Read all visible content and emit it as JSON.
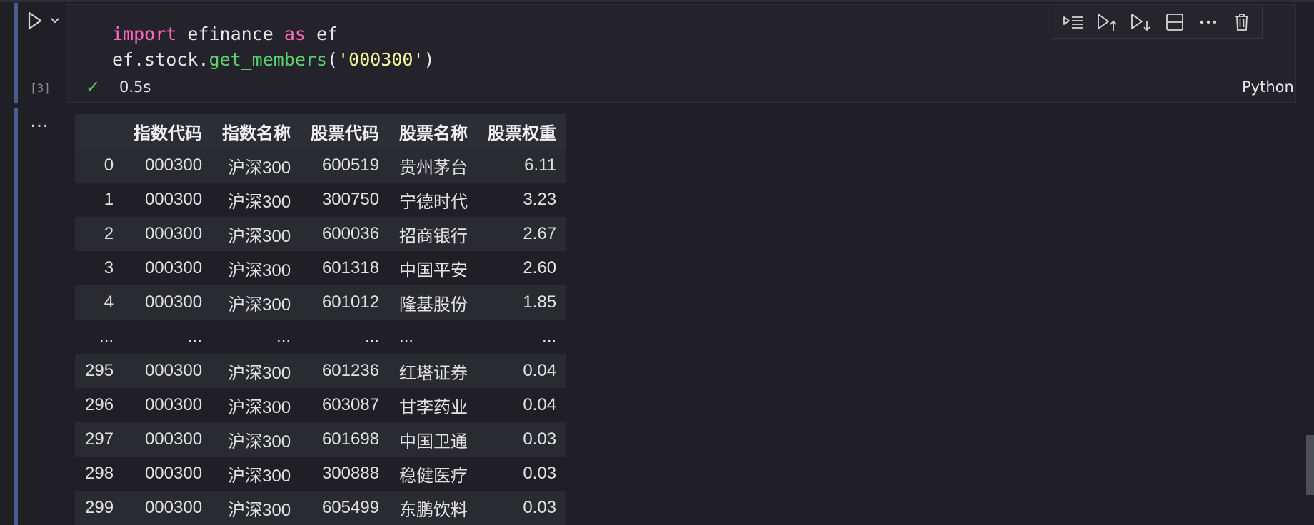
{
  "cell": {
    "execution_count": "[3]",
    "code_lines": [
      [
        {
          "t": "import",
          "c": "kw"
        },
        {
          "t": " efinance ",
          "c": ""
        },
        {
          "t": "as",
          "c": "kw"
        },
        {
          "t": " ef",
          "c": ""
        }
      ],
      [
        {
          "t": "ef.stock.",
          "c": ""
        },
        {
          "t": "get_members",
          "c": "fn"
        },
        {
          "t": "(",
          "c": ""
        },
        {
          "t": "'000300'",
          "c": "str"
        },
        {
          "t": ")",
          "c": ""
        }
      ]
    ],
    "duration": "0.5s",
    "language": "Python"
  },
  "toolbar": {
    "actions": [
      "run-by-line",
      "execute-above",
      "execute-below",
      "split-cell",
      "more",
      "delete"
    ]
  },
  "output": {
    "more_label": "…",
    "columns": [
      "",
      "指数代码",
      "指数名称",
      "股票代码",
      "股票名称",
      "股票权重"
    ],
    "rows": [
      [
        "0",
        "000300",
        "沪深300",
        "600519",
        "贵州茅台",
        "6.11"
      ],
      [
        "1",
        "000300",
        "沪深300",
        "300750",
        "宁德时代",
        "3.23"
      ],
      [
        "2",
        "000300",
        "沪深300",
        "600036",
        "招商银行",
        "2.67"
      ],
      [
        "3",
        "000300",
        "沪深300",
        "601318",
        "中国平安",
        "2.60"
      ],
      [
        "4",
        "000300",
        "沪深300",
        "601012",
        "隆基股份",
        "1.85"
      ],
      [
        "...",
        "...",
        "...",
        "...",
        "...",
        "..."
      ],
      [
        "295",
        "000300",
        "沪深300",
        "601236",
        "红塔证券",
        "0.04"
      ],
      [
        "296",
        "000300",
        "沪深300",
        "603087",
        "甘李药业",
        "0.04"
      ],
      [
        "297",
        "000300",
        "沪深300",
        "601698",
        "中国卫通",
        "0.03"
      ],
      [
        "298",
        "000300",
        "沪深300",
        "300888",
        "稳健医疗",
        "0.03"
      ],
      [
        "299",
        "000300",
        "沪深300",
        "605499",
        "东鹏饮料",
        "0.03"
      ]
    ]
  },
  "colors": {
    "keyword": "#ff6ac1",
    "function": "#5bd16f",
    "string": "#f4f99d",
    "cell_bar": "#4d5a92",
    "success": "#5fc15a"
  }
}
